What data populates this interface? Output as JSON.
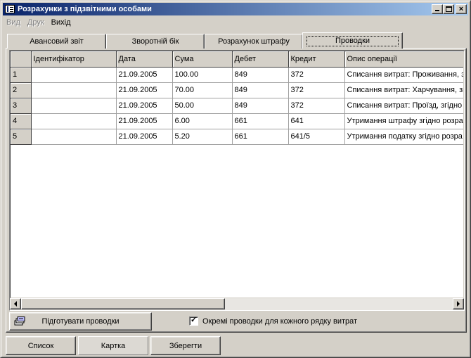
{
  "window": {
    "title": "Розрахунки з підзвітними особами"
  },
  "menu": [
    {
      "label": "Вид",
      "enabled": false
    },
    {
      "label": "Друк",
      "enabled": false
    },
    {
      "label": "Вихід",
      "enabled": true
    }
  ],
  "tabs": [
    {
      "label": "Авансовий звіт"
    },
    {
      "label": "Зворотній бік"
    },
    {
      "label": "Розрахунок штрафу"
    },
    {
      "label": "Проводки"
    }
  ],
  "active_tab": "Проводки",
  "grid": {
    "columns": [
      "",
      "Ідентифікатор",
      "Дата",
      "Сума",
      "Дебет",
      "Кредит",
      "Опис операції"
    ],
    "rows": [
      {
        "n": "1",
        "id": "",
        "date": "21.09.2005",
        "sum": "100.00",
        "debit": "849",
        "credit": "372",
        "desc": "Списання витрат: Проживання, з"
      },
      {
        "n": "2",
        "id": "",
        "date": "21.09.2005",
        "sum": "70.00",
        "debit": "849",
        "credit": "372",
        "desc": "Списання витрат: Харчування, зг"
      },
      {
        "n": "3",
        "id": "",
        "date": "21.09.2005",
        "sum": "50.00",
        "debit": "849",
        "credit": "372",
        "desc": "Списання витрат: Проїзд, згідно"
      },
      {
        "n": "4",
        "id": "",
        "date": "21.09.2005",
        "sum": "6.00",
        "debit": "661",
        "credit": "641",
        "desc": "Утримання штрафу згідно розрах"
      },
      {
        "n": "5",
        "id": "",
        "date": "21.09.2005",
        "sum": "5.20",
        "debit": "661",
        "credit": "641/5",
        "desc": "Утримання податку згідно розра"
      }
    ]
  },
  "actions": {
    "prepare_label": "Підготувати проводки",
    "separate_label": "Окремі проводки для кожного рядку витрат",
    "separate_checked": true
  },
  "bottom": {
    "list_label": "Список",
    "card_label": "Картка",
    "save_label": "Зберегти"
  }
}
